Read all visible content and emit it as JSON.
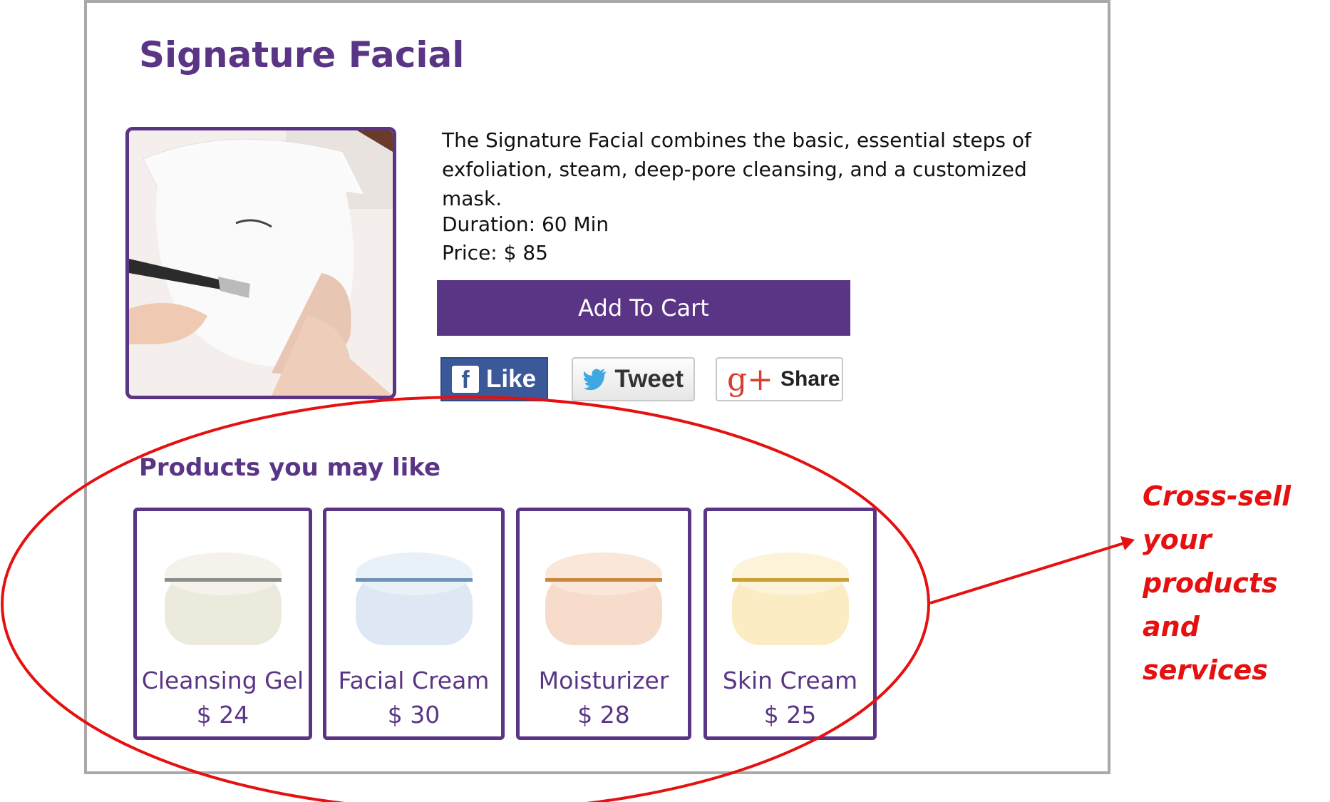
{
  "page": {
    "title": "Signature Facial",
    "hero_image": "facial-mask-photo",
    "description": "The Signature Facial combines the basic, essential steps of exfoliation, steam, deep-pore cleansing, and a customized mask.",
    "duration": "Duration: 60 Min",
    "price": "Price: $ 85"
  },
  "actions": {
    "add_to_cart": "Add To Cart",
    "social": [
      {
        "label": "Like",
        "icon": "facebook-icon",
        "glyph": "f"
      },
      {
        "label": "Tweet",
        "icon": "twitter-bird-icon"
      },
      {
        "label": "Share",
        "icon": "google-plus-icon",
        "glyph": "g+"
      }
    ]
  },
  "related": {
    "title": "Products you may like",
    "items": [
      {
        "name": "Cleansing Gel",
        "price": "$ 24",
        "jar_color": "#ece9dd",
        "band_color": "#8a8f8c"
      },
      {
        "name": "Facial Cream",
        "price": "$ 30",
        "jar_color": "#dde8f4",
        "band_color": "#6f93b7"
      },
      {
        "name": "Moisturizer",
        "price": "$ 28",
        "jar_color": "#f8dccb",
        "band_color": "#c98840"
      },
      {
        "name": "Skin Cream",
        "price": "$ 25",
        "jar_color": "#fbecc4",
        "band_color": "#c9a236"
      }
    ]
  },
  "annotation": {
    "note_lines": [
      "Cross-sell",
      "your products",
      "and services"
    ],
    "color": "#e51010"
  },
  "colors": {
    "brand_purple": "#5b3585",
    "facebook_blue": "#3b5998",
    "frame_gray": "#a9a9a9"
  }
}
